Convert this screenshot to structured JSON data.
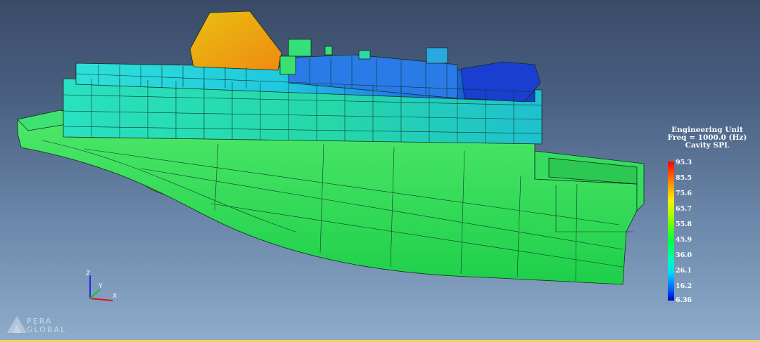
{
  "legend": {
    "title_line1": "Engineering Unit",
    "title_line2": "Freq = 1000.0 (Hz)",
    "title_line3": "Cavity SPL",
    "ticks": [
      "95.3",
      "85.5",
      "75.6",
      "65.7",
      "55.8",
      "45.9",
      "36.0",
      "26.1",
      "16.2",
      "6.36"
    ]
  },
  "axes": {
    "z": "Z",
    "y": "Y",
    "x": "X"
  },
  "logo": {
    "line1": "PERA",
    "line2": "GLOBAL"
  },
  "colors": {
    "hull_green": "#35e35a",
    "cabin_cyan": "#1fd8c8",
    "bridge_blue": "#1a5fe0",
    "funnel_orange": "#f0a818",
    "bulb_yellow": "#e8c020"
  }
}
